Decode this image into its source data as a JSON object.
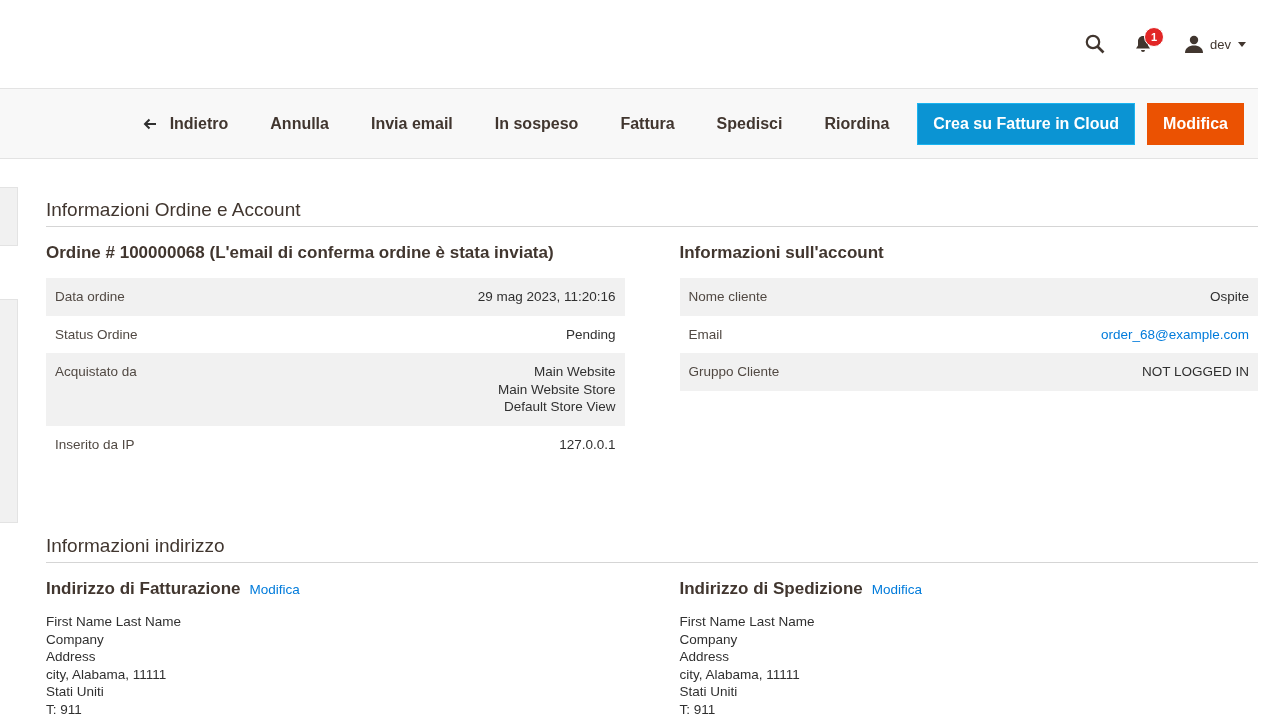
{
  "header": {
    "notification_count": "1",
    "user": "dev"
  },
  "toolbar": {
    "buttons": [
      {
        "kind": "back",
        "label": "Indietro"
      },
      {
        "kind": "plain",
        "label": "Annulla"
      },
      {
        "kind": "plain",
        "label": "Invia email"
      },
      {
        "kind": "plain",
        "label": "In sospeso"
      },
      {
        "kind": "plain",
        "label": "Fattura"
      },
      {
        "kind": "plain",
        "label": "Spedisci"
      },
      {
        "kind": "plain",
        "label": "Riordina"
      },
      {
        "kind": "primary",
        "label": "Crea su Fatture in Cloud"
      },
      {
        "kind": "accent",
        "label": "Modifica"
      }
    ]
  },
  "order_section": {
    "title": "Informazioni Ordine e Account",
    "order": {
      "title": "Ordine # 100000068 (L'email di conferma ordine è stata inviata)",
      "rows": [
        {
          "label": "Data ordine",
          "value": [
            "29 mag 2023, 11:20:16"
          ]
        },
        {
          "label": "Status Ordine",
          "value": [
            "Pending"
          ]
        },
        {
          "label": "Acquistato da",
          "value": [
            "Main Website",
            "Main Website Store",
            "Default Store View"
          ]
        },
        {
          "label": "Inserito da IP",
          "value": [
            "127.0.0.1"
          ]
        }
      ]
    },
    "account": {
      "title": "Informazioni sull'account",
      "rows": [
        {
          "label": "Nome cliente",
          "value": [
            "Ospite"
          ],
          "kind": "text"
        },
        {
          "label": "Email",
          "value": [
            "order_68@example.com"
          ],
          "kind": "link"
        },
        {
          "label": "Gruppo Cliente",
          "value": [
            "NOT LOGGED IN"
          ],
          "kind": "text"
        }
      ]
    }
  },
  "address_section": {
    "title": "Informazioni indirizzo",
    "addresses": [
      {
        "title": "Indirizzo di Fatturazione",
        "edit_link": "Modifica",
        "lines": [
          "First Name Last Name",
          "Company",
          "Address",
          "city, Alabama, 11111",
          "Stati Uniti",
          "T: 911"
        ]
      },
      {
        "title": "Indirizzo di Spedizione",
        "edit_link": "Modifica",
        "lines": [
          "First Name Last Name",
          "Company",
          "Address",
          "city, Alabama, 11111",
          "Stati Uniti",
          "T: 911"
        ]
      }
    ]
  }
}
